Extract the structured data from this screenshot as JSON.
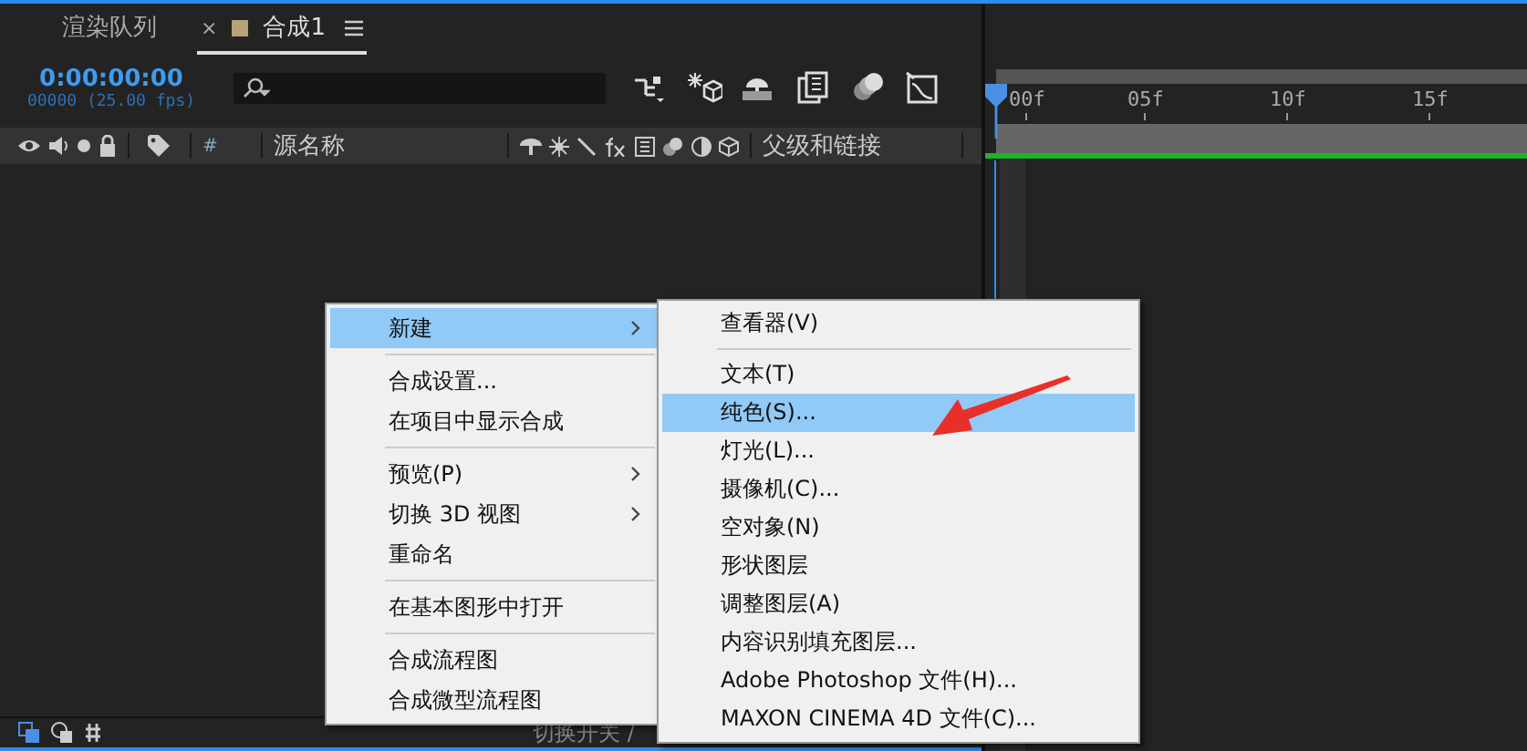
{
  "panel_tabs": [
    {
      "label": "渲染队列",
      "selected": false,
      "kind": "plain"
    },
    {
      "label": "合成1",
      "selected": true,
      "kind": "comp",
      "close": "×"
    }
  ],
  "timecode": {
    "time": "0:00:00:00",
    "frames": "00000 (25.00 fps)"
  },
  "columns": {
    "number": "#",
    "source_name": "源名称",
    "parent": "父级和链接"
  },
  "ruler": {
    "labels": [
      "00f",
      "05f",
      "10f",
      "15f"
    ]
  },
  "context_menu": {
    "items": [
      {
        "kind": "item",
        "label": "新建",
        "submenu": true,
        "selected": true
      },
      {
        "kind": "separator"
      },
      {
        "kind": "item",
        "label": "合成设置...",
        "submenu": false,
        "selected": false
      },
      {
        "kind": "item",
        "label": "在项目中显示合成",
        "submenu": false,
        "selected": false
      },
      {
        "kind": "separator"
      },
      {
        "kind": "item",
        "label": "预览(P)",
        "submenu": true,
        "selected": false
      },
      {
        "kind": "item",
        "label": "切换 3D 视图",
        "submenu": true,
        "selected": false
      },
      {
        "kind": "item",
        "label": "重命名",
        "submenu": false,
        "selected": false
      },
      {
        "kind": "separator"
      },
      {
        "kind": "item",
        "label": "在基本图形中打开",
        "submenu": false,
        "selected": false
      },
      {
        "kind": "separator"
      },
      {
        "kind": "item",
        "label": "合成流程图",
        "submenu": false,
        "selected": false
      },
      {
        "kind": "item",
        "label": "合成微型流程图",
        "submenu": false,
        "selected": false
      }
    ]
  },
  "submenu": {
    "items": [
      {
        "kind": "item",
        "label": "查看器(V)",
        "selected": false
      },
      {
        "kind": "separator"
      },
      {
        "kind": "item",
        "label": "文本(T)",
        "selected": false
      },
      {
        "kind": "item",
        "label": "纯色(S)...",
        "selected": true
      },
      {
        "kind": "item",
        "label": "灯光(L)...",
        "selected": false
      },
      {
        "kind": "item",
        "label": "摄像机(C)...",
        "selected": false
      },
      {
        "kind": "item",
        "label": "空对象(N)",
        "selected": false
      },
      {
        "kind": "item",
        "label": "形状图层",
        "selected": false
      },
      {
        "kind": "item",
        "label": "调整图层(A)",
        "selected": false
      },
      {
        "kind": "item",
        "label": "内容识别填充图层...",
        "selected": false
      },
      {
        "kind": "item",
        "label": "Adobe Photoshop 文件(H)...",
        "selected": false
      },
      {
        "kind": "item",
        "label": "MAXON CINEMA 4D 文件(C)...",
        "selected": false
      }
    ]
  },
  "status_bar": {
    "text": "切换开关 /"
  }
}
